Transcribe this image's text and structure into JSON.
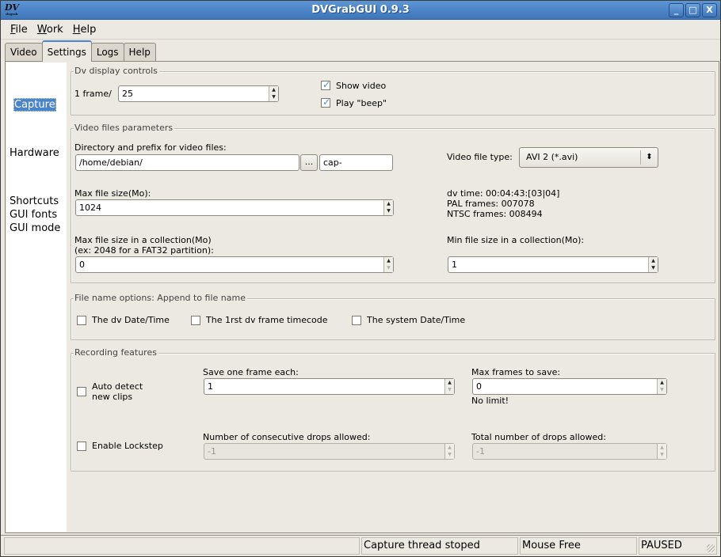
{
  "window": {
    "title": "DVGrabGUI 0.9.3",
    "app_icon": "dvgrab-logo-icon",
    "controls": {
      "minimize": "_",
      "maximize": "□",
      "close": "X"
    }
  },
  "menubar": {
    "items": [
      {
        "label": "File",
        "mnemonic": "F",
        "rest": "ile"
      },
      {
        "label": "Work",
        "mnemonic": "W",
        "rest": "ork"
      },
      {
        "label": "Help",
        "mnemonic": "H",
        "rest": "elp"
      }
    ]
  },
  "tabs": [
    {
      "label": "Video"
    },
    {
      "label": "Settings",
      "active": true
    },
    {
      "label": "Logs"
    },
    {
      "label": "Help"
    }
  ],
  "sidebar": {
    "items": [
      {
        "label": "Capture",
        "selected": true
      },
      {
        "label": "Hardware"
      },
      {
        "label": "Shortcuts"
      },
      {
        "label": "GUI fonts"
      },
      {
        "label": "GUI mode"
      }
    ]
  },
  "dv_display": {
    "legend": "Dv display controls",
    "frame_label": "1 frame/",
    "frame_value": "25",
    "show_video": {
      "label": "Show video",
      "checked": true
    },
    "play_beep": {
      "label": "Play \"beep\"",
      "checked": true
    }
  },
  "video_files": {
    "legend": "Video files parameters",
    "dir_label": "Directory and prefix for video files:",
    "dir_value": "/home/debian/",
    "browse_label": "...",
    "prefix_value": "cap-",
    "file_type_label": "Video file type:",
    "file_type_value": "AVI 2 (*.avi)",
    "max_size_label": "Max file size(Mo):",
    "max_size_value": "1024",
    "dv_time": "dv time: 00:04:43:[03|04]",
    "pal_frames": "PAL frames: 007078",
    "ntsc_frames": "NTSC frames: 008494",
    "max_collection_label": "Max file size in a collection(Mo)",
    "max_collection_hint": "(ex: 2048 for a FAT32 partition):",
    "max_collection_value": "0",
    "min_collection_label": "Min file size in a collection(Mo):",
    "min_collection_value": "1"
  },
  "file_name_options": {
    "legend": "File name options: Append to file name",
    "options": [
      {
        "label": "The dv Date/Time",
        "checked": false
      },
      {
        "label": "The 1rst dv frame timecode",
        "checked": false
      },
      {
        "label": "The system Date/Time",
        "checked": false
      }
    ]
  },
  "recording": {
    "legend": "Recording features",
    "auto_detect": {
      "label_line1": "Auto detect",
      "label_line2": "new clips",
      "checked": false
    },
    "save_one_frame_label": "Save one frame each:",
    "save_one_frame_value": "1",
    "max_frames_label": "Max frames to save:",
    "max_frames_value": "0",
    "max_frames_note": "No limit!",
    "lockstep": {
      "label": "Enable Lockstep",
      "checked": false
    },
    "consecutive_drops_label": "Number of consecutive drops allowed:",
    "consecutive_drops_value": "-1",
    "total_drops_label": "Total number of drops allowed:",
    "total_drops_value": "-1"
  },
  "statusbar": {
    "message": "",
    "capture_status": "Capture thread stoped",
    "mouse_status": "Mouse Free",
    "state": "PAUSED"
  }
}
